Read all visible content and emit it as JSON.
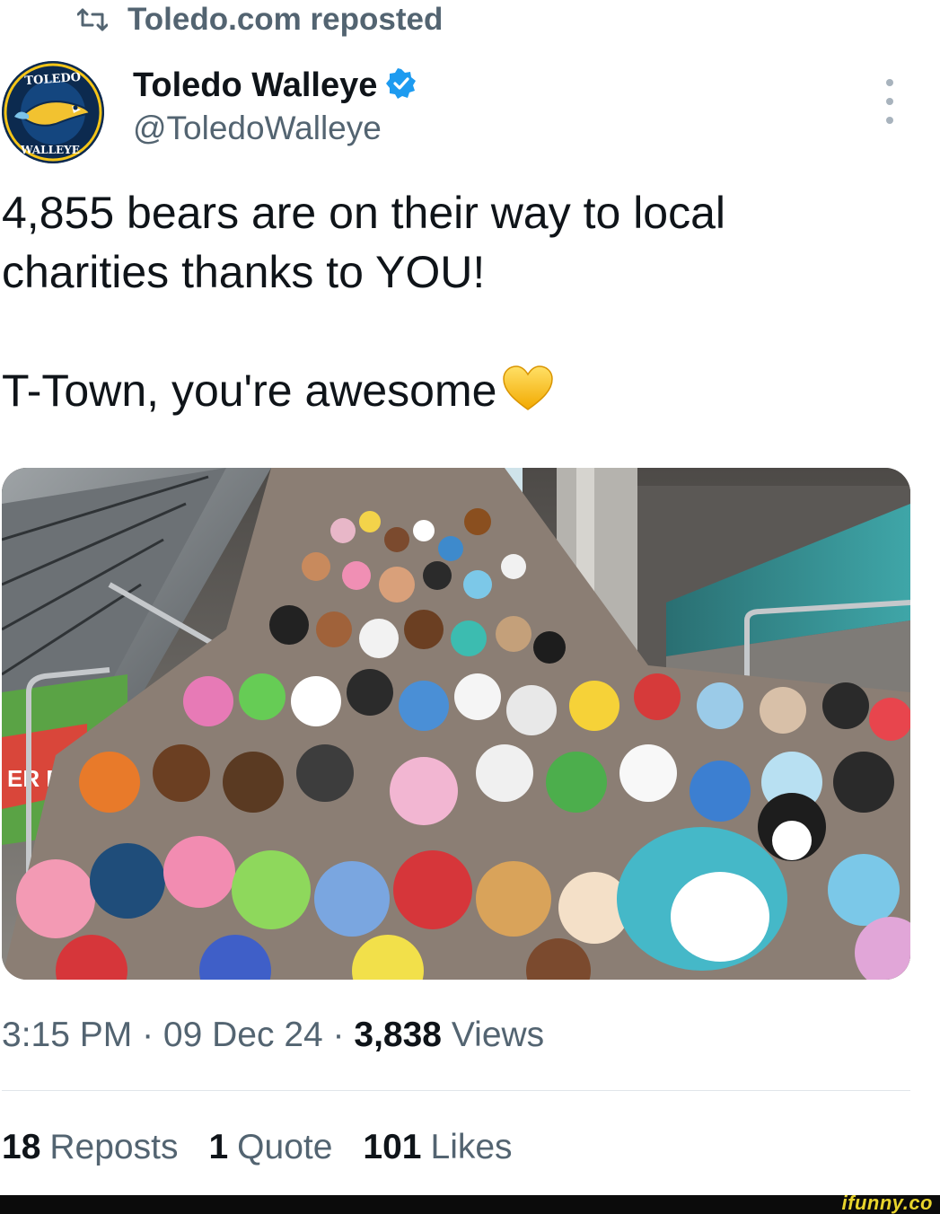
{
  "repost": {
    "icon": "repost-icon",
    "label": "Toledo.com reposted"
  },
  "author": {
    "avatar_text": "TOLEDO WALLEYE",
    "display_name": "Toledo Walleye",
    "verified_icon": "verified-badge-icon",
    "handle": "@ToledoWalleye"
  },
  "more_icon": "more-vertical-icon",
  "tweet": {
    "line1": "4,855 bears are on their way to local charities thanks to YOU!",
    "line2": "T-Town, you're awesome",
    "emoji": "yellow-heart"
  },
  "media": {
    "alt_icon": "photo-stuffed-animals-on-stairs",
    "sign_text": "ER PRO"
  },
  "meta": {
    "time": "3:15 PM",
    "separator": " · ",
    "date": "09 Dec 24",
    "views_count": "3,838",
    "views_label": "Views"
  },
  "stats": {
    "reposts_count": "18",
    "reposts_label": "Reposts",
    "quotes_count": "1",
    "quotes_label": "Quote",
    "likes_count": "101",
    "likes_label": "Likes"
  },
  "watermark": "ifunny.co",
  "colors": {
    "text": "#0f1419",
    "secondary": "#536471",
    "verified": "#1d9bf0",
    "heart": "#ffcc33"
  }
}
